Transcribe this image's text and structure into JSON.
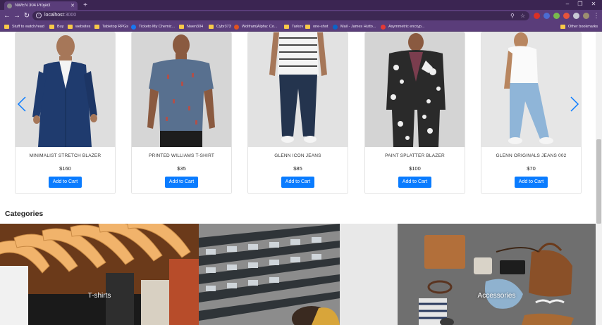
{
  "browser": {
    "tab_title": "NWEN 304 Project",
    "url_host": "localhost",
    "url_port": ":3000",
    "bookmarks": [
      {
        "label": "Stuff to watch/read",
        "icon": "folder-icon"
      },
      {
        "label": "Buy",
        "icon": "folder-icon"
      },
      {
        "label": "websites",
        "icon": "folder-icon"
      },
      {
        "label": "Tabletop RPGs",
        "icon": "folder-icon"
      },
      {
        "label": "Ticketo My Chemic...",
        "icon": "facebook-icon"
      },
      {
        "label": "Nwen304",
        "icon": "folder-icon"
      },
      {
        "label": "Cybr373",
        "icon": "folder-icon"
      },
      {
        "label": "Wolfram|Alpha: Co...",
        "icon": "wolfram-icon"
      },
      {
        "label": "Tarkov",
        "icon": "folder-icon"
      },
      {
        "label": "one-shot",
        "icon": "folder-icon"
      },
      {
        "label": "Mail - James Hutto...",
        "icon": "outlook-icon"
      },
      {
        "label": "Asymmetric encryp...",
        "icon": "link-icon"
      }
    ],
    "other_bookmarks": "Other bookmarks"
  },
  "products": [
    {
      "name": "MINIMALIST STRETCH BLAZER",
      "price": "$160",
      "button": "Add to Cart"
    },
    {
      "name": "PRINTED WILLIAMS T-SHIRT",
      "price": "$35",
      "button": "Add to Cart"
    },
    {
      "name": "GLENN ICON JEANS",
      "price": "$85",
      "button": "Add to Cart"
    },
    {
      "name": "PAINT SPLATTER BLAZER",
      "price": "$100",
      "button": "Add to Cart"
    },
    {
      "name": "GLENN ORIGINALS JEANS 002",
      "price": "$70",
      "button": "Add to Cart"
    }
  ],
  "categories_heading": "Categories",
  "categories": [
    {
      "label": "T-shirts"
    },
    {
      "label": ""
    },
    {
      "label": "Accessories"
    }
  ],
  "colors": {
    "browser_purple": "#5a3d7a",
    "button_blue": "#0a7cff",
    "carousel_arrow": "#0a7cff"
  }
}
